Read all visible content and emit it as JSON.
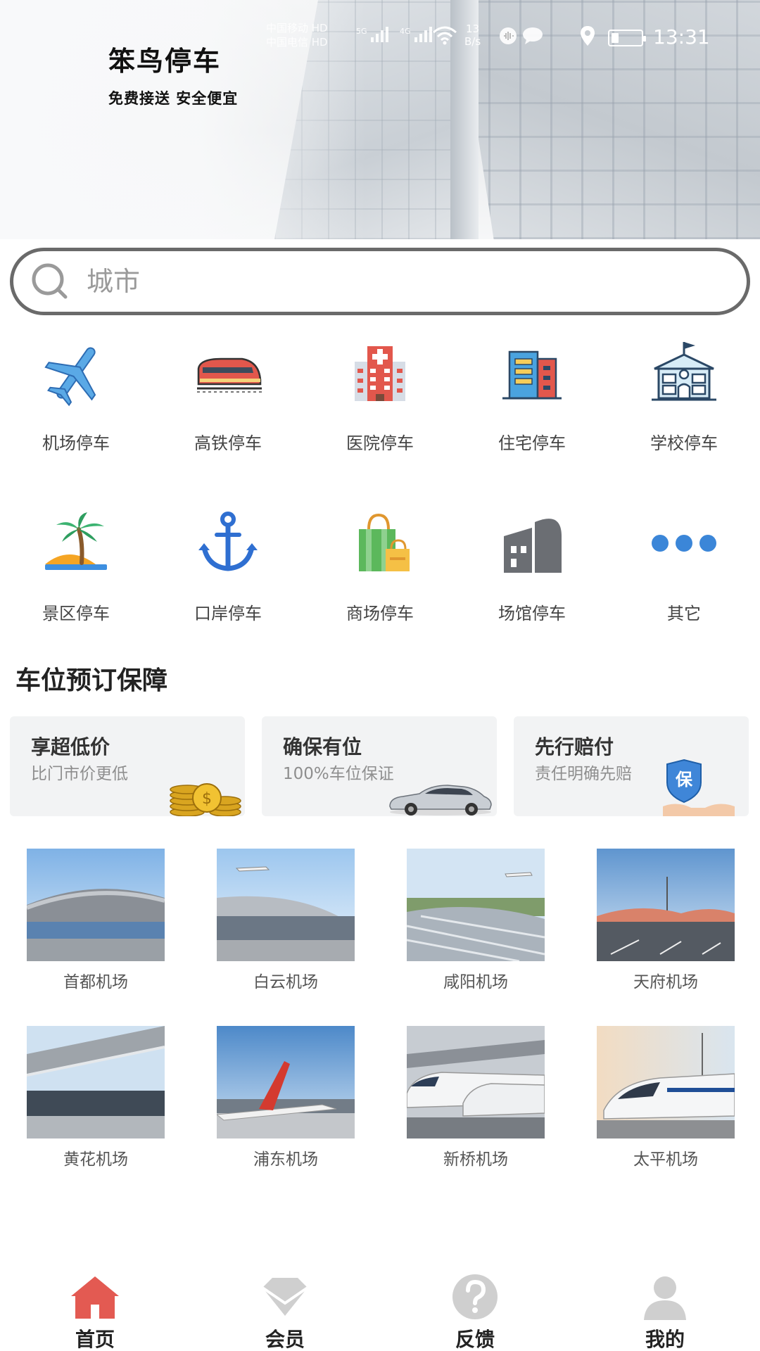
{
  "app": {
    "title": "笨鸟停车",
    "slogan": "免费接送  安全便宜"
  },
  "status_bar": {
    "carrier1": "中国移动 HD",
    "carrier2": "中国电信 HD",
    "net1": "5G",
    "net2": "4G",
    "speed_value": "13",
    "speed_unit": "B/s",
    "time": "13:31"
  },
  "search": {
    "placeholder": "城市",
    "value": ""
  },
  "categories": [
    {
      "label": "机场停车",
      "icon": "airplane-icon"
    },
    {
      "label": "高铁停车",
      "icon": "high-speed-train-icon"
    },
    {
      "label": "医院停车",
      "icon": "hospital-icon"
    },
    {
      "label": "住宅停车",
      "icon": "residence-icon"
    },
    {
      "label": "学校停车",
      "icon": "school-icon"
    },
    {
      "label": "景区停车",
      "icon": "palm-island-icon"
    },
    {
      "label": "口岸停车",
      "icon": "anchor-icon"
    },
    {
      "label": "商场停车",
      "icon": "shopping-bag-icon"
    },
    {
      "label": "场馆停车",
      "icon": "venue-icon"
    },
    {
      "label": "其它",
      "icon": "more-dots-icon"
    }
  ],
  "guarantee": {
    "title": "车位预订保障",
    "cards": [
      {
        "title": "享超低价",
        "subtitle": "比门市价更低",
        "icon": "gold-coins-icon"
      },
      {
        "title": "确保有位",
        "subtitle": "100%车位保证",
        "icon": "car-icon"
      },
      {
        "title": "先行赔付",
        "subtitle": "责任明确先赔",
        "icon": "shield-hands-icon",
        "badge": "保"
      }
    ]
  },
  "airports": [
    {
      "name": "首都机场"
    },
    {
      "name": "白云机场"
    },
    {
      "name": "咸阳机场"
    },
    {
      "name": "天府机场"
    },
    {
      "name": "黄花机场"
    },
    {
      "name": "浦东机场"
    },
    {
      "name": "新桥机场"
    },
    {
      "name": "太平机场"
    }
  ],
  "tabbar": {
    "items": [
      {
        "label": "首页",
        "icon": "home-icon",
        "active": true
      },
      {
        "label": "会员",
        "icon": "diamond-icon",
        "active": false
      },
      {
        "label": "反馈",
        "icon": "question-icon",
        "active": false
      },
      {
        "label": "我的",
        "icon": "user-icon",
        "active": false
      }
    ]
  },
  "colors": {
    "home_tab": "#e35a52",
    "inactive_tab": "#cfcfcf",
    "icon_blue": "#3d7fd6",
    "icon_red": "#e2574c",
    "more_dots": "#3b86d8"
  }
}
